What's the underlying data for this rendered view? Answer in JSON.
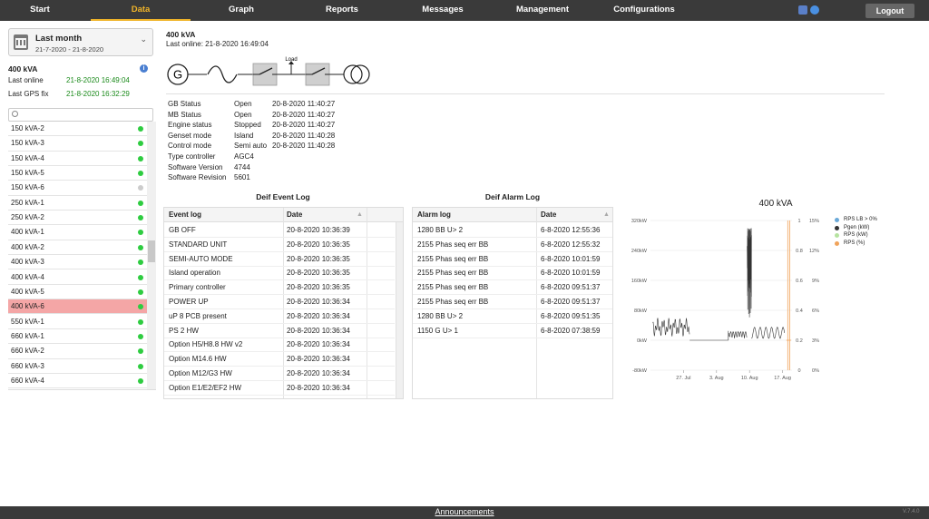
{
  "nav": {
    "items": [
      {
        "label": "Start"
      },
      {
        "label": "Data"
      },
      {
        "label": "Graph"
      },
      {
        "label": "Reports"
      },
      {
        "label": "Messages"
      },
      {
        "label": "Management"
      },
      {
        "label": "Configurations"
      }
    ],
    "active": "Data",
    "logout": "Logout"
  },
  "sidebar": {
    "period_title": "Last month",
    "period_range": "21-7-2020 - 21-8-2020",
    "device_title": "400 kVA",
    "last_online_label": "Last online",
    "last_online_value": "21-8-2020 16:49:04",
    "last_gps_label": "Last GPS fix",
    "last_gps_value": "21-8-2020 16:32:29",
    "devices": [
      {
        "name": "150 kVA-2",
        "status": "green"
      },
      {
        "name": "150 kVA-3",
        "status": "green"
      },
      {
        "name": "150 kVA-4",
        "status": "green"
      },
      {
        "name": "150 kVA-5",
        "status": "green"
      },
      {
        "name": "150 kVA-6",
        "status": "grey"
      },
      {
        "name": "250 kVA-1",
        "status": "green"
      },
      {
        "name": "250 kVA-2",
        "status": "green"
      },
      {
        "name": "400 kVA-1",
        "status": "green"
      },
      {
        "name": "400 kVA-2",
        "status": "green"
      },
      {
        "name": "400 kVA-3",
        "status": "green"
      },
      {
        "name": "400 kVA-4",
        "status": "green"
      },
      {
        "name": "400 kVA-5",
        "status": "green"
      },
      {
        "name": "400 kVA-6",
        "status": "green"
      },
      {
        "name": "550 kVA-1",
        "status": "green"
      },
      {
        "name": "660 kVA-1",
        "status": "green"
      },
      {
        "name": "660 kVA-2",
        "status": "green"
      },
      {
        "name": "660 kVA-3",
        "status": "green"
      },
      {
        "name": "660 kVA-4",
        "status": "green"
      }
    ],
    "selected": "400 kVA-6"
  },
  "header": {
    "title": "400 kVA",
    "last_online": "Last online: 21-8-2020 16:49:04"
  },
  "diagram": {
    "generator_letter": "G",
    "load_label": "Load"
  },
  "status": [
    {
      "label": "GB Status",
      "value": "Open",
      "time": "20-8-2020 11:40:27"
    },
    {
      "label": "MB Status",
      "value": "Open",
      "time": "20-8-2020 11:40:27"
    },
    {
      "label": "Engine status",
      "value": "Stopped",
      "time": "20-8-2020 11:40:27"
    },
    {
      "label": "Genset mode",
      "value": "Island",
      "time": "20-8-2020 11:40:28"
    },
    {
      "label": "Control mode",
      "value": "Semi auto",
      "time": "20-8-2020 11:40:28"
    },
    {
      "label": "Type controller",
      "value": "AGC4",
      "time": ""
    },
    {
      "label": "Software Version",
      "value": "4744",
      "time": ""
    },
    {
      "label": "Software Revision",
      "value": "5601",
      "time": ""
    }
  ],
  "event_log": {
    "title": "Deif Event Log",
    "col_event": "Event log",
    "col_date": "Date",
    "rows": [
      {
        "event": "GB OFF",
        "date": "20-8-2020 10:36:39"
      },
      {
        "event": "STANDARD UNIT",
        "date": "20-8-2020 10:36:35"
      },
      {
        "event": "SEMI-AUTO MODE",
        "date": "20-8-2020 10:36:35"
      },
      {
        "event": "Island operation",
        "date": "20-8-2020 10:36:35"
      },
      {
        "event": "Primary controller",
        "date": "20-8-2020 10:36:35"
      },
      {
        "event": "POWER UP",
        "date": "20-8-2020 10:36:34"
      },
      {
        "event": "uP 8 PCB present",
        "date": "20-8-2020 10:36:34"
      },
      {
        "event": "PS 2 HW",
        "date": "20-8-2020 10:36:34"
      },
      {
        "event": "Option H5/H8.8 HW v2",
        "date": "20-8-2020 10:36:34"
      },
      {
        "event": "Option M14.6 HW",
        "date": "20-8-2020 10:36:34"
      },
      {
        "event": "Option M12/G3 HW",
        "date": "20-8-2020 10:36:34"
      },
      {
        "event": "Option E1/E2/EF2 HW",
        "date": "20-8-2020 10:36:34"
      }
    ]
  },
  "alarm_log": {
    "title": "Deif Alarm Log",
    "col_alarm": "Alarm log",
    "col_date": "Date",
    "rows": [
      {
        "alarm": "1280 BB U> 2",
        "date": "6-8-2020 12:55:36"
      },
      {
        "alarm": "2155 Phas seq err BB",
        "date": "6-8-2020 12:55:32"
      },
      {
        "alarm": "2155 Phas seq err BB",
        "date": "6-8-2020 10:01:59"
      },
      {
        "alarm": "2155 Phas seq err BB",
        "date": "6-8-2020 10:01:59"
      },
      {
        "alarm": "2155 Phas seq err BB",
        "date": "6-8-2020 09:51:37"
      },
      {
        "alarm": "2155 Phas seq err BB",
        "date": "6-8-2020 09:51:37"
      },
      {
        "alarm": "1280 BB U> 2",
        "date": "6-8-2020 09:51:35"
      },
      {
        "alarm": "1150 G U> 1",
        "date": "6-8-2020 07:38:59"
      }
    ]
  },
  "chart_data": {
    "type": "line",
    "title": "400 kVA",
    "y_left_ticks": [
      "320kW",
      "240kW",
      "160kW",
      "80kW",
      "0kW",
      "-80kW"
    ],
    "y_left_range": [
      -80,
      320
    ],
    "y_mid_ticks": [
      "1",
      "0.8",
      "0.6",
      "0.4",
      "0.2",
      "0"
    ],
    "y_right_ticks": [
      "15%",
      "12%",
      "9%",
      "6%",
      "3%",
      "0%"
    ],
    "x_ticks": [
      "27. Jul",
      "3. Aug",
      "10. Aug",
      "17. Aug"
    ],
    "legend": [
      {
        "label": "RPS LB > 0%",
        "color": "#6aa9d8"
      },
      {
        "label": "Pgen (kW)",
        "color": "#333333"
      },
      {
        "label": "RPS (kW)",
        "color": "#b6e3a0"
      },
      {
        "label": "RPS (%)",
        "color": "#f0a35a"
      }
    ]
  },
  "footer": {
    "announcements": "Announcements",
    "version": "V.7.4.0"
  }
}
